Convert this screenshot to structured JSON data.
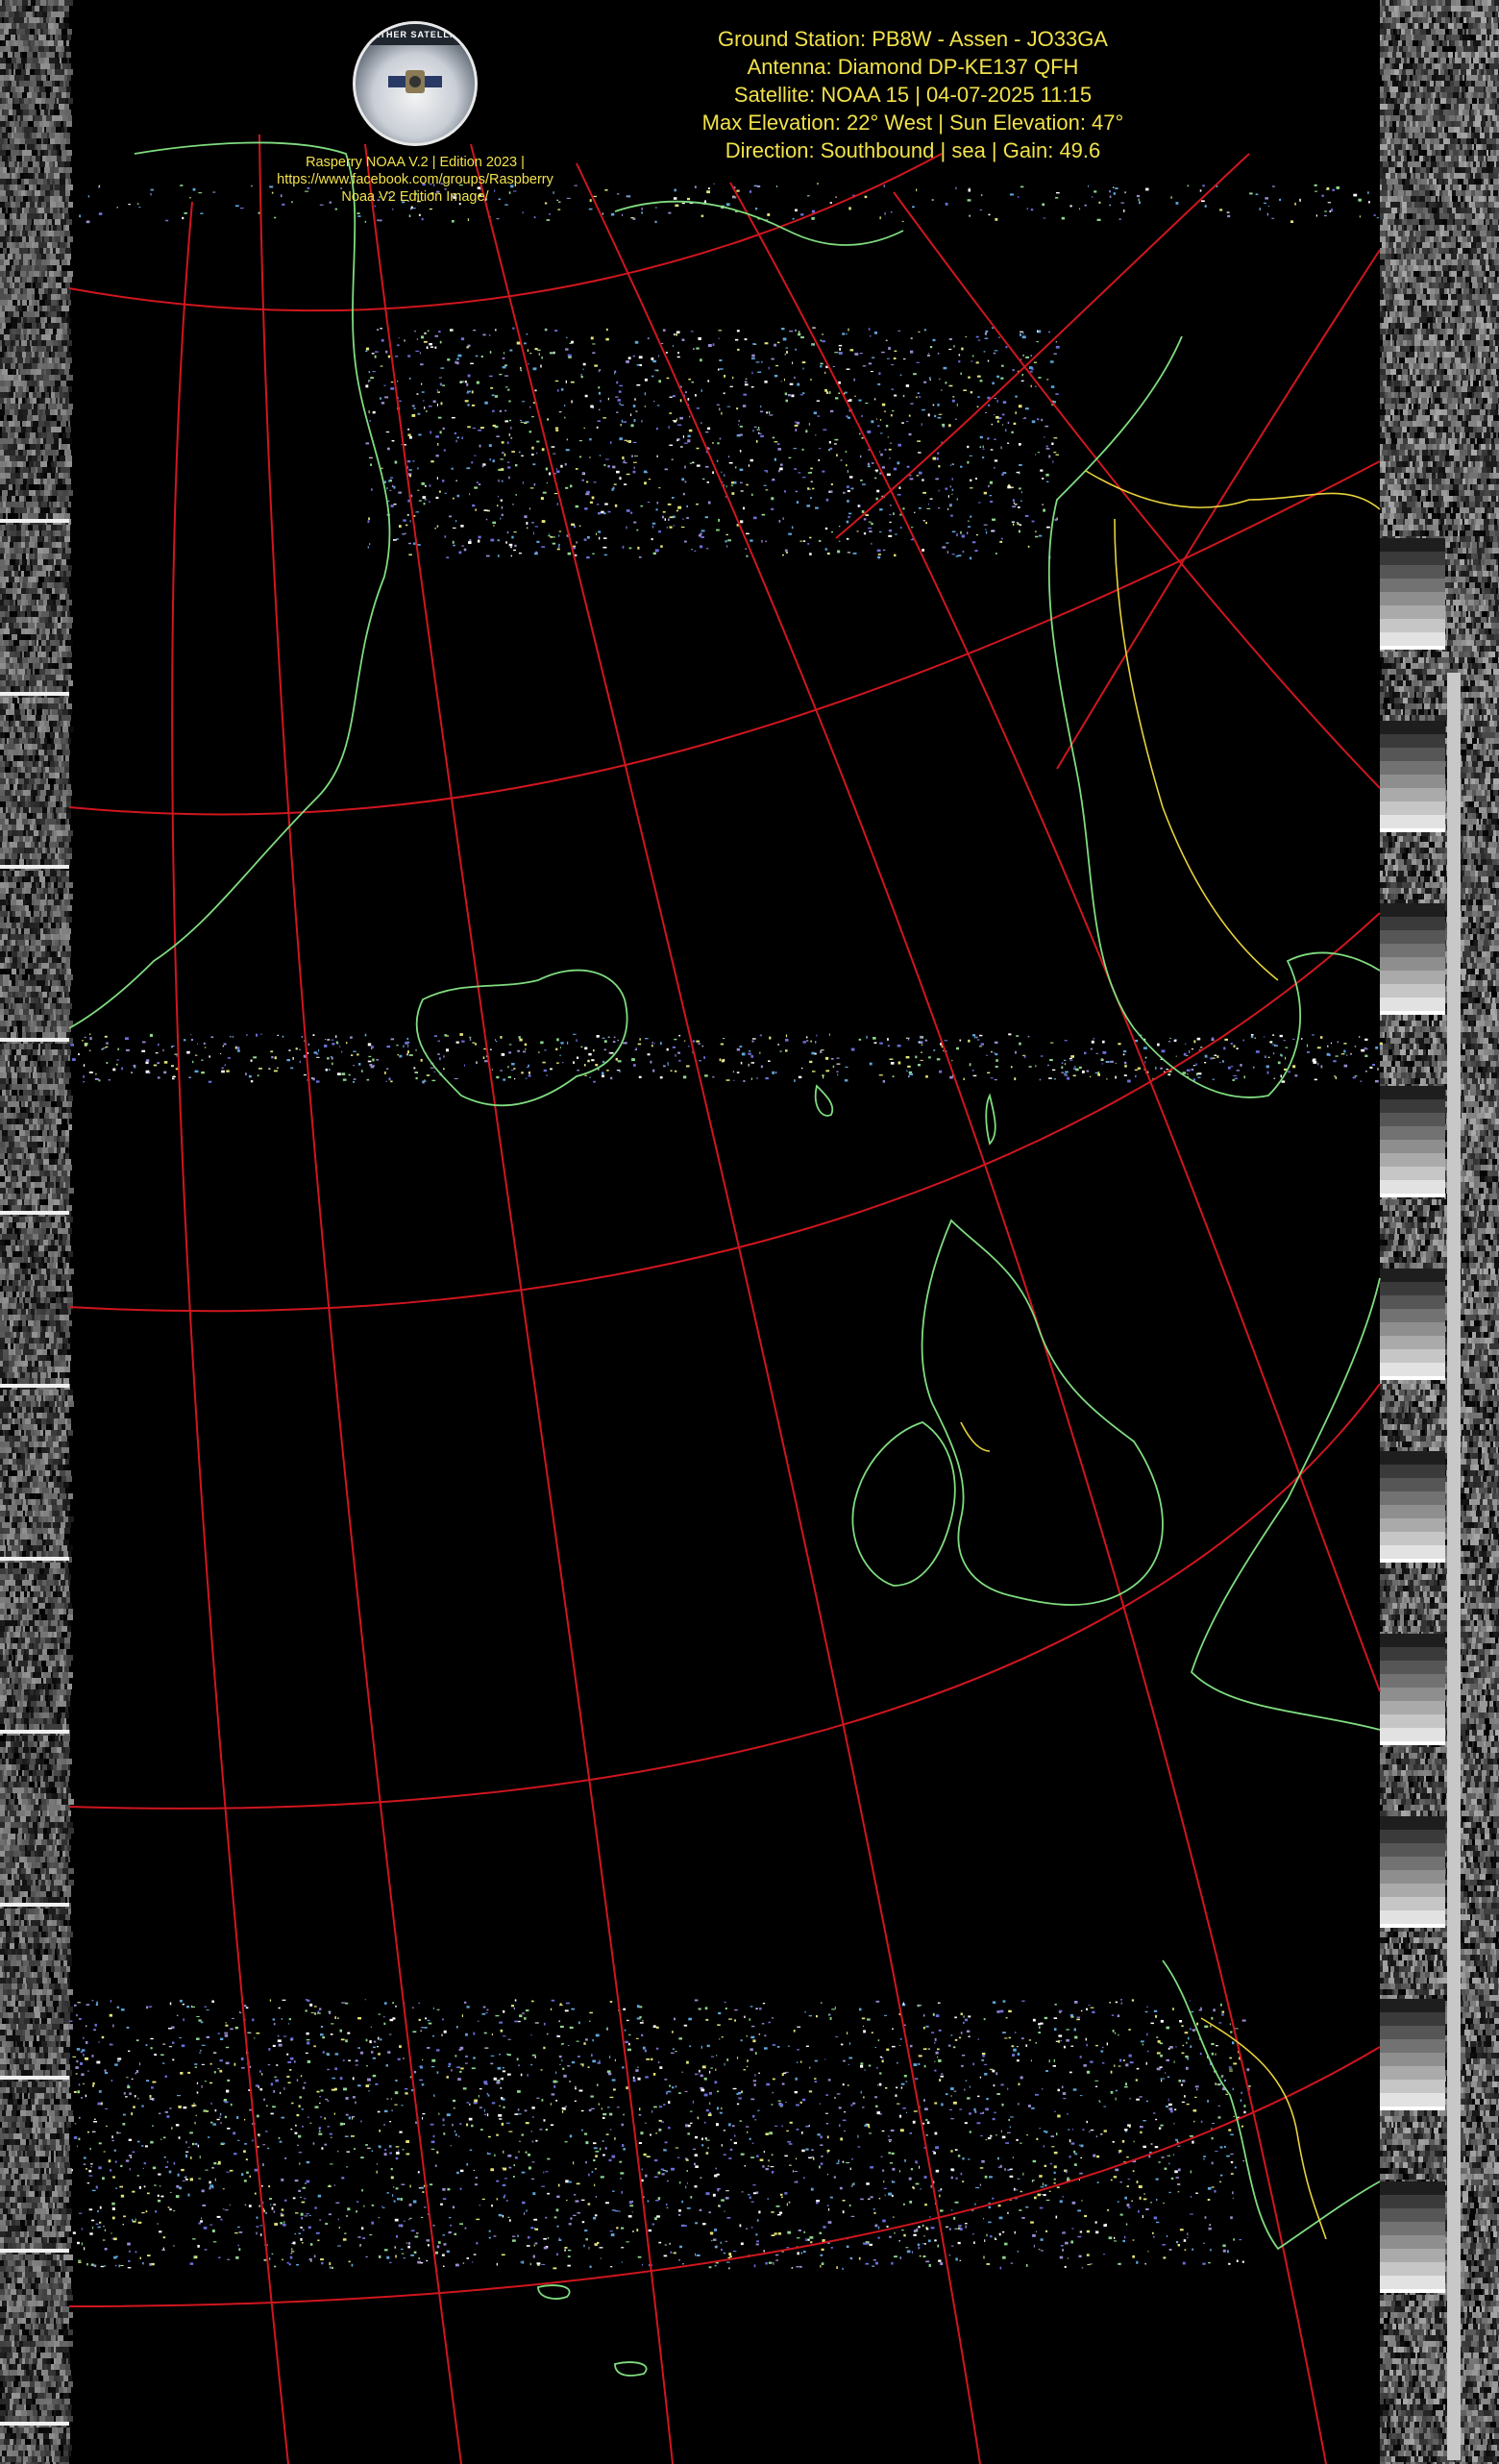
{
  "header": {
    "line1": "Ground Station: PB8W - Assen - JO33GA",
    "line2": "Antenna: Diamond DP-KE137 QFH",
    "line3": "Satellite: NOAA 15 | 04-07-2025 11:15",
    "line4": "Max Elevation: 22° West | Sun Elevation: 47°",
    "line5": "Direction: Southbound | sea | Gain: 49.6"
  },
  "logo": {
    "badge_text": "WEATHER SATELLITES",
    "caption_line1": "Rasperry NOAA V.2 | Edition 2023 |",
    "caption_line2": "https://www.facebook.com/groups/Raspberry",
    "caption_line3": "Noaa V2 Edition Image/"
  },
  "colors": {
    "background": "#000000",
    "graticule": "#d0161e",
    "coastline": "#7fdc7f",
    "border": "#e8d23a",
    "text": "#f2e24a"
  }
}
